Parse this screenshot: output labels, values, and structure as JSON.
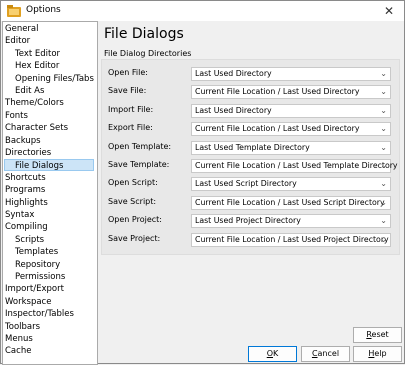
{
  "window": {
    "title": "Options",
    "close_glyph": "✕"
  },
  "sidebar": {
    "items": [
      {
        "label": "General",
        "indent": 0
      },
      {
        "label": "Editor",
        "indent": 0
      },
      {
        "label": "Text Editor",
        "indent": 1
      },
      {
        "label": "Hex Editor",
        "indent": 1
      },
      {
        "label": "Opening Files/Tabs",
        "indent": 1
      },
      {
        "label": "Edit As",
        "indent": 1
      },
      {
        "label": "Theme/Colors",
        "indent": 0
      },
      {
        "label": "Fonts",
        "indent": 0
      },
      {
        "label": "Character Sets",
        "indent": 0
      },
      {
        "label": "Backups",
        "indent": 0
      },
      {
        "label": "Directories",
        "indent": 0
      },
      {
        "label": "File Dialogs",
        "indent": 1,
        "selected": true
      },
      {
        "label": "Shortcuts",
        "indent": 0
      },
      {
        "label": "Programs",
        "indent": 0
      },
      {
        "label": "Highlights",
        "indent": 0
      },
      {
        "label": "Syntax",
        "indent": 0
      },
      {
        "label": "Compiling",
        "indent": 0
      },
      {
        "label": "Scripts",
        "indent": 1
      },
      {
        "label": "Templates",
        "indent": 1
      },
      {
        "label": "Repository",
        "indent": 1
      },
      {
        "label": "Permissions",
        "indent": 1
      },
      {
        "label": "Import/Export",
        "indent": 0
      },
      {
        "label": "Workspace",
        "indent": 0
      },
      {
        "label": "Inspector/Tables",
        "indent": 0
      },
      {
        "label": "Toolbars",
        "indent": 0
      },
      {
        "label": "Menus",
        "indent": 0
      },
      {
        "label": "Cache",
        "indent": 0
      }
    ]
  },
  "panel": {
    "title": "File Dialogs",
    "group_label": "File Dialog Directories",
    "rows": [
      {
        "label": "Open File:",
        "value": "Last Used Directory"
      },
      {
        "label": "Save File:",
        "value": "Current File Location / Last Used Directory"
      },
      {
        "label": "Import File:",
        "value": "Last Used Directory"
      },
      {
        "label": "Export File:",
        "value": "Current File Location / Last Used Directory"
      },
      {
        "label": "Open Template:",
        "value": "Last Used Template Directory"
      },
      {
        "label": "Save Template:",
        "value": "Current File Location / Last Used Template Directory"
      },
      {
        "label": "Open Script:",
        "value": "Last Used Script Directory"
      },
      {
        "label": "Save Script:",
        "value": "Current File Location / Last Used Script Directory"
      },
      {
        "label": "Open Project:",
        "value": "Last Used Project Directory"
      },
      {
        "label": "Save Project:",
        "value": "Current File Location / Last Used Project Directory"
      }
    ]
  },
  "buttons": {
    "reset": {
      "pre": "",
      "ul": "R",
      "post": "eset"
    },
    "ok": {
      "pre": "",
      "ul": "O",
      "post": "K"
    },
    "cancel": {
      "pre": "",
      "ul": "C",
      "post": "ancel"
    },
    "help": {
      "pre": "",
      "ul": "H",
      "post": "elp"
    }
  },
  "icons": {
    "combo_chevron": "⌄",
    "app_icon": "folder-app-icon"
  },
  "colors": {
    "selection": "#cce4f7",
    "default_button_border": "#0078d7"
  }
}
